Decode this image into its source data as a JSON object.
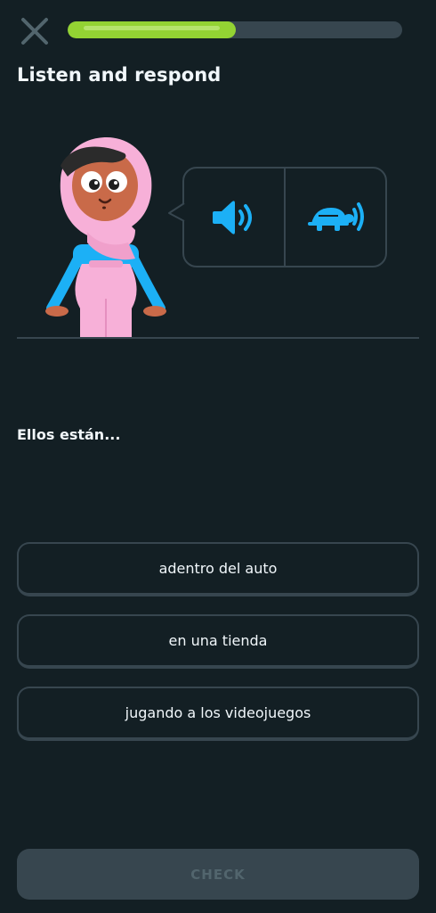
{
  "header": {
    "close_icon": "close-icon",
    "progress": 0.503,
    "title": "Listen and respond"
  },
  "colors": {
    "background": "#131f24",
    "progress_fill": "#93d333",
    "progress_track": "#37464f",
    "audio_icon": "#1cb0f6",
    "border": "#37464f",
    "character_hijab": "#f7b0d8",
    "character_shirt": "#1cb0f6"
  },
  "audio": {
    "normal_icon": "speaker-icon",
    "slow_icon": "turtle-speaker-icon"
  },
  "prompt": "Ellos están...",
  "options": [
    {
      "label": "adentro del auto"
    },
    {
      "label": "en una tienda"
    },
    {
      "label": "jugando a los videojuegos"
    }
  ],
  "footer": {
    "check_label": "CHECK"
  }
}
